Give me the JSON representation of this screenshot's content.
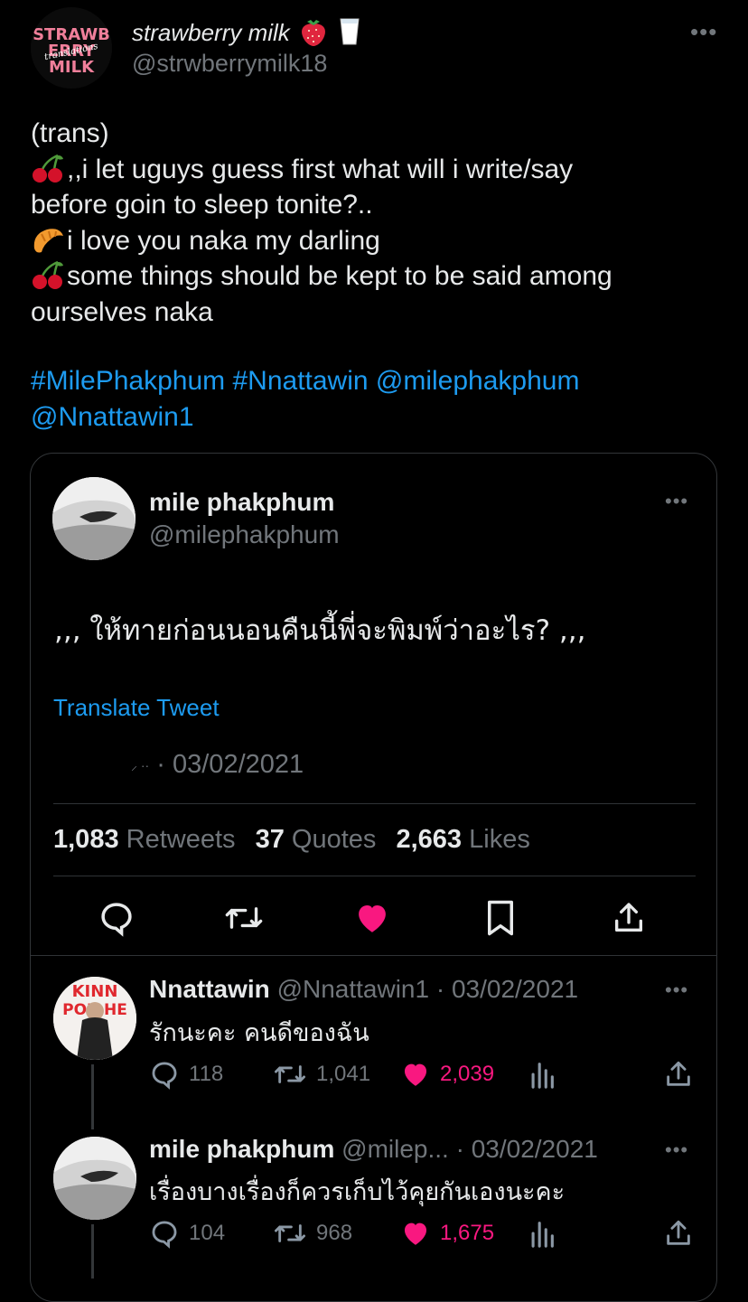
{
  "author": {
    "name": "strawberry milk",
    "handle": "@strwberrymilk18",
    "avatar_logo_text": "STRAWB ERRY MILK translations"
  },
  "tweet": {
    "lines": [
      "(trans)",
      ",,i let uguys guess first what will i write/say",
      "before goin to sleep tonite?..",
      "i love you naka my darling",
      "some things should be kept to be said among",
      "ourselves naka"
    ],
    "tags": [
      "#MilePhakphum",
      "#Nnattawin",
      "@milephakphum",
      "@Nnattawin1"
    ]
  },
  "quoted": {
    "name": "mile phakphum",
    "handle": "@milephakphum",
    "text": ",,, ให้ทายก่อนนอนคืนนี้พี่จะพิมพ์ว่าอะไร? ,,,",
    "translate_label": "Translate Tweet",
    "timestamp": "· 03/02/2021",
    "stats": {
      "retweets_value": "1,083",
      "retweets_label": "Retweets",
      "quotes_value": "37",
      "quotes_label": "Quotes",
      "likes_value": "2,663",
      "likes_label": "Likes"
    }
  },
  "replies": [
    {
      "name": "Nnattawin",
      "meta": "@Nnattawin1 · 03/02/2021",
      "text": "รักนะคะ คนดีของฉัน",
      "replies": "118",
      "retweets": "1,041",
      "likes": "2,039",
      "avatar_text": "KINN PORSCHE"
    },
    {
      "name": "mile phakphum",
      "meta": "@milep... · 03/02/2021",
      "text": "เรื่องบางเรื่องก็ควรเก็บไว้คุยกันเองนะคะ",
      "replies": "104",
      "retweets": "968",
      "likes": "1,675"
    }
  ],
  "colors": {
    "background": "#000000",
    "text": "#e7e9ea",
    "muted": "#71767b",
    "link": "#1d9bf0",
    "like": "#f91880",
    "border": "#2f3336"
  }
}
